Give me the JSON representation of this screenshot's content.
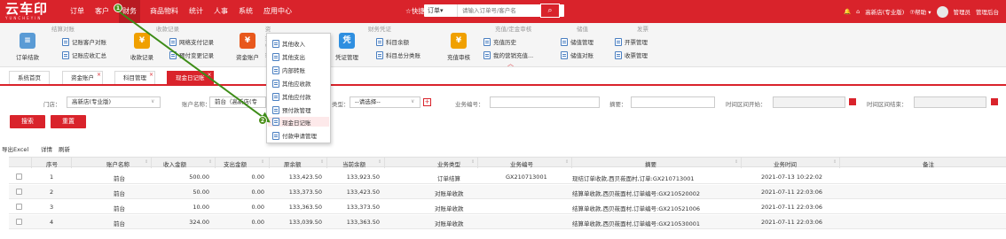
{
  "app": {
    "logo_text": "云车印",
    "logo_sub": "YUNCHEYIN",
    "nav": [
      "订单",
      "客户",
      "财务",
      "商品物料",
      "统计",
      "人事",
      "系统",
      "应用中心"
    ],
    "quick_label": "☆快捷功能",
    "search_type": "订单▾",
    "search_placeholder": "请输入订单号/客户名",
    "search_icon_glyph": "⌕",
    "store": "高新店(专业版)",
    "help": "⑦帮助 ▾",
    "admin": "管理员",
    "backend": "管理后台",
    "brand_color": "#d9232b"
  },
  "ribbon": {
    "groups": {
      "settle": "结算对账",
      "collect": "收款记录",
      "fund": "资金管理",
      "finance": "财务凭证",
      "prepay": "充值/定金审核",
      "stored": "储值",
      "invoice": "发票"
    },
    "tools": {
      "order_settle": "订单结款",
      "order_settle_icon": "≡",
      "cust_reconcile": "记账客户对账",
      "receivable": "记账应收汇总",
      "collect_record": "收款记录",
      "collect_icon": "¥",
      "online_pay": "网络支付记录",
      "prepay_change": "预付变更记录",
      "fund_account": "资金账户",
      "fund_icon": "¥",
      "voucher": "凭证管理",
      "voucher_icon": "凭",
      "subject_balance": "科目余额",
      "subject_summary": "科目总分类账",
      "recharge_review": "充值审核",
      "recharge_icon": "¥",
      "recharge_history": "充值历史",
      "marketing_recharge": "我的营销充值...",
      "stored_manage": "储值管理",
      "stored_reconcile": "储值对账",
      "invoice_manage": "开票管理",
      "receipt_manage": "收票管理",
      "collapse_glyph": "︿"
    }
  },
  "dropdown": [
    "其他收入",
    "其他支出",
    "内部转账",
    "其他应收款",
    "其他应付款",
    "预付款管理",
    "现金日记账",
    "付款申请管理"
  ],
  "steps": {
    "one": "1",
    "two": "2"
  },
  "tabs": [
    "系统首页",
    "资金账户",
    "科目管理",
    "现金日记账"
  ],
  "filters": {
    "store_label": "门店：",
    "store_value": "高新店(专业版)",
    "account_label": "账户名称：",
    "account_value": "前台（高新店(专",
    "type_label": "类型：",
    "type_value": "--请选择--",
    "bizno_label": "业务编号：",
    "summary_label": "摘要：",
    "start_label": "时间区间开始：",
    "end_label": "时间区间结束：",
    "search_btn": "搜索",
    "reset_btn": "重置",
    "plus": "+"
  },
  "toolbar": {
    "export": "导出Excel",
    "detail": "详情",
    "refresh": "刷新"
  },
  "table": {
    "headers": [
      "序号",
      "账户名称",
      "收入金额",
      "支出金额",
      "原余额",
      "当前余额",
      "业务类型",
      "业务编号",
      "摘要",
      "业务时间",
      "备注"
    ],
    "rows": [
      [
        "1",
        "前台",
        "500.00",
        "0.00",
        "133,423.50",
        "133,923.50",
        "订单结算",
        "GX210713001",
        "现结订单收款,西贝莜面村,订单:GX210713001",
        "2021-07-13 10:22:02",
        ""
      ],
      [
        "2",
        "前台",
        "50.00",
        "0.00",
        "133,373.50",
        "133,423.50",
        "对账单收款",
        "",
        "结算单收款,西贝莜面村,订单编号:GX210520002",
        "2021-07-11 22:03:06",
        ""
      ],
      [
        "3",
        "前台",
        "10.00",
        "0.00",
        "133,363.50",
        "133,373.50",
        "对账单收款",
        "",
        "结算单收款,西贝莜面村,订单编号:GX210521006",
        "2021-07-11 22:03:06",
        ""
      ],
      [
        "4",
        "前台",
        "324.00",
        "0.00",
        "133,039.50",
        "133,363.50",
        "对账单收款",
        "",
        "结算单收款,西贝莜面村,订单编号:GX210530001",
        "2021-07-11 22:03:06",
        ""
      ]
    ]
  }
}
